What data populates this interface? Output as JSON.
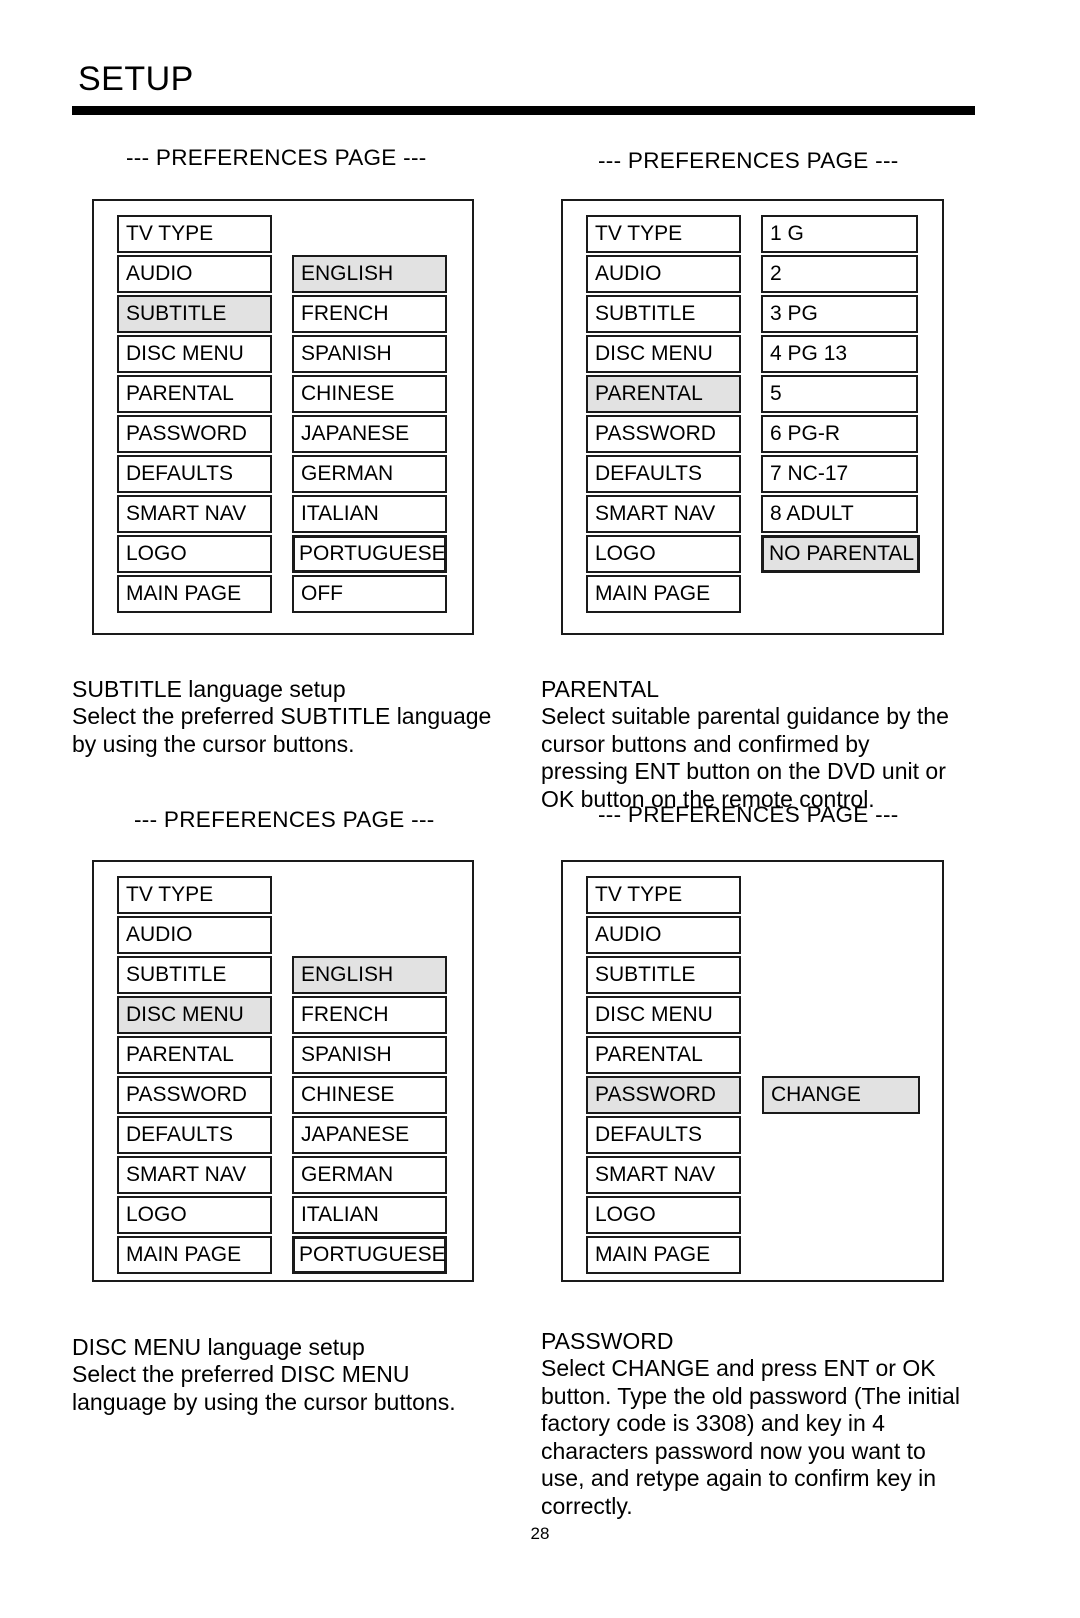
{
  "page": {
    "title": "SETUP",
    "number": "28"
  },
  "section_header": "--- PREFERENCES PAGE ---",
  "menu_items": {
    "tv_type": "TV TYPE",
    "audio": "AUDIO",
    "subtitle": "SUBTITLE",
    "disc_menu": "DISC MENU",
    "parental": "PARENTAL",
    "password": "PASSWORD",
    "defaults": "DEFAULTS",
    "smart_nav": "SMART NAV",
    "logo": "LOGO",
    "main_page": "MAIN PAGE"
  },
  "screens": [
    {
      "id": "subtitle-screen",
      "header": "--- PREFERENCES PAGE ---",
      "left_column": [
        {
          "label": "TV TYPE",
          "selected": false
        },
        {
          "label": "AUDIO",
          "selected": false
        },
        {
          "label": "SUBTITLE",
          "selected": true
        },
        {
          "label": "DISC MENU",
          "selected": false
        },
        {
          "label": "PARENTAL",
          "selected": false
        },
        {
          "label": "PASSWORD",
          "selected": false
        },
        {
          "label": "DEFAULTS",
          "selected": false
        },
        {
          "label": "SMART NAV",
          "selected": false
        },
        {
          "label": "LOGO",
          "selected": false
        },
        {
          "label": "MAIN PAGE",
          "selected": false
        }
      ],
      "right_column": [
        {
          "label": "ENGLISH",
          "selected": true,
          "row": 1
        },
        {
          "label": "FRENCH",
          "selected": false,
          "row": 2
        },
        {
          "label": "SPANISH",
          "selected": false,
          "row": 3
        },
        {
          "label": "CHINESE",
          "selected": false,
          "row": 4
        },
        {
          "label": "JAPANESE",
          "selected": false,
          "row": 5
        },
        {
          "label": "GERMAN",
          "selected": false,
          "row": 6
        },
        {
          "label": "ITALIAN",
          "selected": false,
          "row": 7
        },
        {
          "label": "PORTUGUESE",
          "selected": false,
          "row": 8,
          "wide": true
        },
        {
          "label": "OFF",
          "selected": false,
          "row": 9
        }
      ],
      "caption_title": "SUBTITLE language setup",
      "caption_body": "Select the preferred SUBTITLE language\nby using the cursor buttons."
    },
    {
      "id": "parental-screen",
      "header": "--- PREFERENCES PAGE ---",
      "left_column": [
        {
          "label": "TV TYPE",
          "selected": false
        },
        {
          "label": "AUDIO",
          "selected": false
        },
        {
          "label": "SUBTITLE",
          "selected": false
        },
        {
          "label": "DISC MENU",
          "selected": false
        },
        {
          "label": "PARENTAL",
          "selected": true
        },
        {
          "label": "PASSWORD",
          "selected": false
        },
        {
          "label": "DEFAULTS",
          "selected": false
        },
        {
          "label": "SMART NAV",
          "selected": false
        },
        {
          "label": "LOGO",
          "selected": false
        },
        {
          "label": "MAIN PAGE",
          "selected": false
        }
      ],
      "right_column": [
        {
          "label": "1 G",
          "selected": false,
          "row": 0
        },
        {
          "label": "2",
          "selected": false,
          "row": 1
        },
        {
          "label": "3 PG",
          "selected": false,
          "row": 2
        },
        {
          "label": "4 PG 13",
          "selected": false,
          "row": 3
        },
        {
          "label": "5",
          "selected": false,
          "row": 4
        },
        {
          "label": "6 PG-R",
          "selected": false,
          "row": 5
        },
        {
          "label": "7 NC-17",
          "selected": false,
          "row": 6
        },
        {
          "label": "8 ADULT",
          "selected": false,
          "row": 7
        },
        {
          "label": "NO PARENTAL",
          "selected": true,
          "row": 8,
          "wide": true
        }
      ],
      "caption_title": "PARENTAL",
      "caption_body": "Select suitable parental guidance by the\ncursor buttons and confirmed by\npressing ENT button on the DVD unit or\nOK button on the remote control."
    },
    {
      "id": "disc-menu-screen",
      "header": "--- PREFERENCES PAGE ---",
      "left_column": [
        {
          "label": "TV TYPE",
          "selected": false
        },
        {
          "label": "AUDIO",
          "selected": false
        },
        {
          "label": "SUBTITLE",
          "selected": false
        },
        {
          "label": "DISC MENU",
          "selected": true
        },
        {
          "label": "PARENTAL",
          "selected": false
        },
        {
          "label": "PASSWORD",
          "selected": false
        },
        {
          "label": "DEFAULTS",
          "selected": false
        },
        {
          "label": "SMART NAV",
          "selected": false
        },
        {
          "label": "LOGO",
          "selected": false
        },
        {
          "label": "MAIN PAGE",
          "selected": false
        }
      ],
      "right_column": [
        {
          "label": "ENGLISH",
          "selected": true,
          "row": 2
        },
        {
          "label": "FRENCH",
          "selected": false,
          "row": 3
        },
        {
          "label": "SPANISH",
          "selected": false,
          "row": 4
        },
        {
          "label": "CHINESE",
          "selected": false,
          "row": 5
        },
        {
          "label": "JAPANESE",
          "selected": false,
          "row": 6
        },
        {
          "label": "GERMAN",
          "selected": false,
          "row": 7
        },
        {
          "label": "ITALIAN",
          "selected": false,
          "row": 8
        },
        {
          "label": "PORTUGUESE",
          "selected": false,
          "row": 9,
          "wide": true
        }
      ],
      "caption_title": "DISC MENU language setup",
      "caption_body": "Select the preferred DISC MENU\nlanguage by using the cursor buttons."
    },
    {
      "id": "password-screen",
      "header": "--- PREFERENCES PAGE ---",
      "left_column": [
        {
          "label": "TV TYPE",
          "selected": false
        },
        {
          "label": "AUDIO",
          "selected": false
        },
        {
          "label": "SUBTITLE",
          "selected": false
        },
        {
          "label": "DISC MENU",
          "selected": false
        },
        {
          "label": "PARENTAL",
          "selected": false
        },
        {
          "label": "PASSWORD",
          "selected": true
        },
        {
          "label": "DEFAULTS",
          "selected": false
        },
        {
          "label": "SMART NAV",
          "selected": false
        },
        {
          "label": "LOGO",
          "selected": false
        },
        {
          "label": "MAIN PAGE",
          "selected": false
        }
      ],
      "right_column": [
        {
          "label": "CHANGE",
          "selected": true,
          "row": 5
        }
      ],
      "caption_title": "PASSWORD",
      "caption_body": "Select CHANGE and press ENT or OK\nbutton.  Type the old password (The initial\nfactory code is 3308) and key in 4\ncharacters password now you want to\nuse, and retype again to confirm key in\ncorrectly."
    }
  ]
}
